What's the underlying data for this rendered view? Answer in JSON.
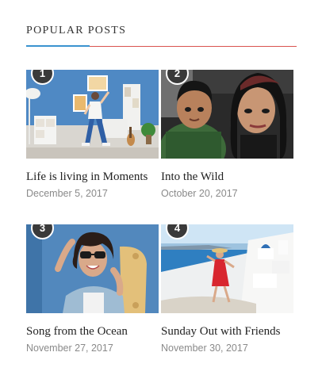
{
  "widget": {
    "title": "POPULAR POSTS"
  },
  "colors": {
    "accent_blue": "#3a93cf",
    "accent_red": "#d9534f",
    "badge": "#3a3a3a",
    "date_text": "#8a8a8a"
  },
  "posts": [
    {
      "number": "1",
      "title": "Life is living in Moments",
      "date": "December 5, 2017",
      "image": "woman-dancing-in-blue-room"
    },
    {
      "number": "2",
      "title": "Into the Wild",
      "date": "October 20, 2017",
      "image": "selfie-in-car"
    },
    {
      "number": "3",
      "title": "Song from the Ocean",
      "date": "November 27, 2017",
      "image": "woman-with-skateboard"
    },
    {
      "number": "4",
      "title": "Sunday Out with Friends",
      "date": "November 30, 2017",
      "image": "woman-in-red-dress-santorini"
    }
  ]
}
